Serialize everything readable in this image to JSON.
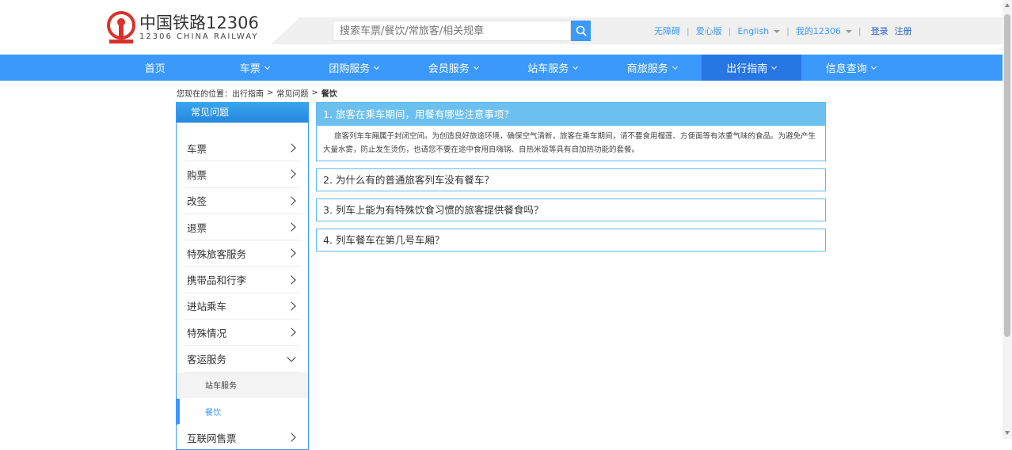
{
  "header": {
    "logo_cn": "中国铁路12306",
    "logo_en": "12306 CHINA RAILWAY",
    "search_placeholder": "搜索车票/餐饮/常旅客/相关规章",
    "links": {
      "accessible": "无障碍",
      "care": "爱心版",
      "english": "English",
      "my12306": "我的12306",
      "login": "登录",
      "register": "注册"
    }
  },
  "nav": {
    "items": [
      {
        "label": "首页"
      },
      {
        "label": "车票"
      },
      {
        "label": "团购服务"
      },
      {
        "label": "会员服务"
      },
      {
        "label": "站车服务"
      },
      {
        "label": "商旅服务"
      },
      {
        "label": "出行指南"
      },
      {
        "label": "信息查询"
      }
    ]
  },
  "breadcrumb": {
    "prefix": "您现在的位置：",
    "items": [
      "出行指南",
      "常见问题",
      "餐饮"
    ],
    "sep": ">"
  },
  "sidebar": {
    "title": "常见问题",
    "items": [
      {
        "label": "车票"
      },
      {
        "label": "购票"
      },
      {
        "label": "改签"
      },
      {
        "label": "退票"
      },
      {
        "label": "特殊旅客服务"
      },
      {
        "label": "携带品和行李"
      },
      {
        "label": "进站乘车"
      },
      {
        "label": "特殊情况"
      },
      {
        "label": "客运服务"
      }
    ],
    "sub_items": [
      {
        "label": "站车服务"
      },
      {
        "label": "餐饮"
      }
    ],
    "after_items": [
      {
        "label": "互联网售票"
      }
    ]
  },
  "faq": {
    "open": {
      "question": "1. 旅客在乘车期间，用餐有哪些注意事项？",
      "answer": "旅客列车车厢属于封闭空间。为创造良好旅途环境，确保空气清新，旅客在乘车期间，请不要食用榴莲、方便面等有浓重气味的食品。为避免产生大量水雾，防止发生烫伤，也请您不要在途中食用自嗨锅、自热米饭等具有自加热功能的套餐。"
    },
    "items": [
      {
        "question": "2. 为什么有的普通旅客列车没有餐车？"
      },
      {
        "question": "3. 列车上能为有特殊饮食习惯的旅客提供餐食吗？"
      },
      {
        "question": "4. 列车餐车在第几号车厢？"
      }
    ]
  },
  "colors": {
    "brand_red": "#d9322a",
    "nav_blue": "#3b99fc",
    "nav_active": "#2676e3",
    "faq_header": "#6cc0ef"
  }
}
